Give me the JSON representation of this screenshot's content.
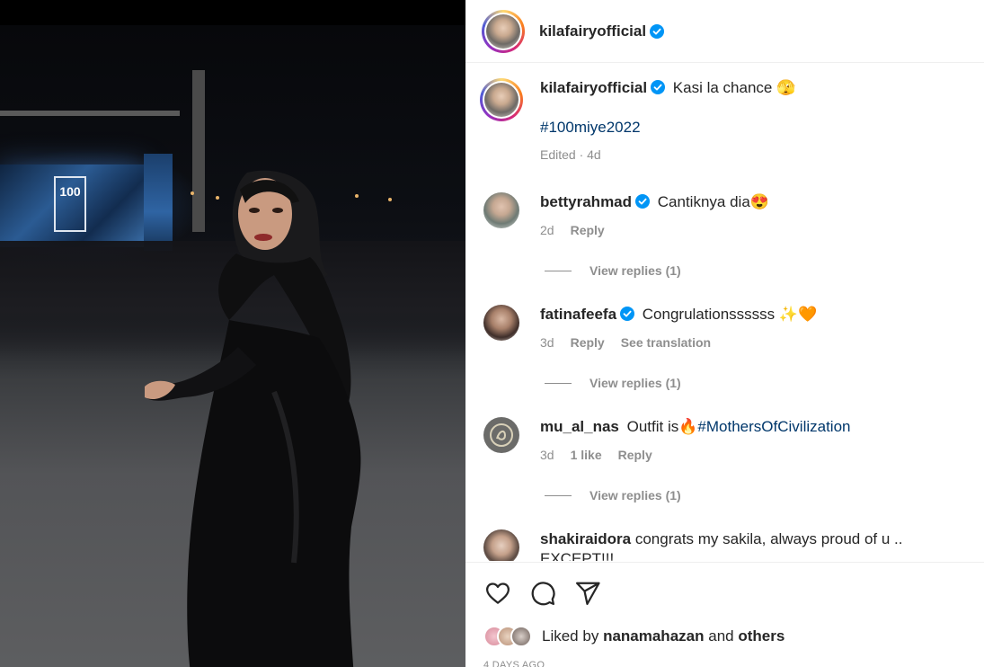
{
  "post": {
    "author": "kilafairyofficial",
    "caption": "Kasi la chance 🫣",
    "hashtag": "#100miye2022",
    "edited": "Edited · 4d",
    "stage_logo": "100"
  },
  "comments": [
    {
      "user": "bettyrahmad",
      "text": "Cantiknya dia😍",
      "time": "2d",
      "reply": "Reply",
      "view_replies": "View replies (1)"
    },
    {
      "user": "fatinafeefa",
      "text": "Congrulationssssss ✨🧡",
      "time": "3d",
      "reply": "Reply",
      "translate": "See translation",
      "view_replies": "View replies (1)"
    },
    {
      "user": "mu_al_nas",
      "text_prefix": "Outfit is🔥",
      "hashtag": "#MothersOfCivilization",
      "time": "3d",
      "likes": "1 like",
      "reply": "Reply",
      "view_replies": "View replies (1)"
    },
    {
      "user": "shakiraidora",
      "text": "congrats my sakila, always proud of u .. EXCEPT!!!"
    }
  ],
  "footer": {
    "liked_by_prefix": "Liked by",
    "liked_by_user": "nanamahazan",
    "and": "and",
    "others": "others",
    "date": "4 DAYS AGO"
  },
  "icons": [
    "heart-icon",
    "comment-icon",
    "share-icon",
    "verified-icon"
  ],
  "colors": {
    "link": "#00376b",
    "verified": "#0095f6",
    "muted": "#8e8e8e"
  }
}
